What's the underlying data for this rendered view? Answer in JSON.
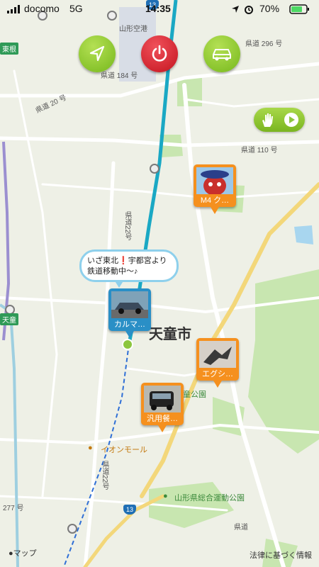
{
  "status_bar": {
    "carrier": "docomo",
    "network": "5G",
    "time": "14:35",
    "battery": "70%"
  },
  "controls": {
    "locate_icon": "navigation-arrow-icon",
    "power_icon": "power-icon",
    "car_icon": "car-icon",
    "hand_icon": "hand-wave-icon",
    "play_icon": "play-icon"
  },
  "map": {
    "city_label": "天童市",
    "labels": {
      "airport": "山形空港",
      "road_296": "県道 296 号",
      "road_184": "県道 184 号",
      "road_20": "県道 20 号",
      "road_110": "県道 110 号",
      "road_22_vertical": "県道22号",
      "road_22_lower": "県道22号",
      "road_277": "277 号",
      "road_lower_right": "県道",
      "higashine": "東根",
      "tendo_tag": "天童",
      "park": "童公園",
      "aeon": "イオンモール",
      "sports_park": "山形県総合運動公園",
      "route_13_top": "13",
      "route_13_bottom": "13"
    }
  },
  "pins": [
    {
      "caption": "M4 ク…",
      "color": "orange"
    },
    {
      "caption": "カルマ…",
      "color": "blue"
    },
    {
      "caption": "エグシ…",
      "color": "orange"
    },
    {
      "caption": "汎用餐…",
      "color": "orange"
    }
  ],
  "bubble": {
    "line1_a": "いざ東北",
    "line1_excl": "❗",
    "line1_b": "宇都宮より",
    "line2": "鉄道移動中〜♪"
  },
  "footer": {
    "apple_maps": "マップ",
    "legal": "法律に基づく情報"
  },
  "colors": {
    "route": "#1aa8c4",
    "control_green": "#8cc63e",
    "control_red": "#d8212b",
    "pin_orange": "#f5901e",
    "pin_blue": "#2a8fc6",
    "park_green": "#c8e6b0"
  }
}
